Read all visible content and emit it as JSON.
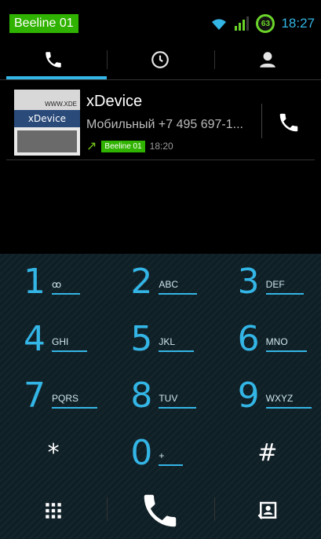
{
  "status_bar": {
    "carrier": "Beeline 01",
    "battery": "63",
    "clock": "18:27",
    "icons": [
      "wifi-icon",
      "signal-icon",
      "battery-icon"
    ]
  },
  "tabs": [
    {
      "icon": "phone-icon",
      "active": true
    },
    {
      "icon": "clock-icon",
      "active": false
    },
    {
      "icon": "contact-icon",
      "active": false
    }
  ],
  "call_log": {
    "name": "xDevice",
    "detail": "Мобильный +7 495 697-1...",
    "sim_badge": "Beeline 01",
    "time": "18:20",
    "thumb_top": "WWW.XDE",
    "thumb_brand": "xDevice",
    "direction_icon": "outgoing-arrow-icon",
    "call_button_icon": "phone-icon"
  },
  "dialpad": {
    "keys": [
      {
        "digit": "1",
        "letters": "ꝏ"
      },
      {
        "digit": "2",
        "letters": "ABC"
      },
      {
        "digit": "3",
        "letters": "DEF"
      },
      {
        "digit": "4",
        "letters": "GHI"
      },
      {
        "digit": "5",
        "letters": "JKL"
      },
      {
        "digit": "6",
        "letters": "MNO"
      },
      {
        "digit": "7",
        "letters": "PQRS"
      },
      {
        "digit": "8",
        "letters": "TUV"
      },
      {
        "digit": "9",
        "letters": "WXYZ"
      },
      {
        "digit": "*",
        "letters": ""
      },
      {
        "digit": "0",
        "letters": "+"
      },
      {
        "digit": "#",
        "letters": ""
      }
    ],
    "bottom_bar": [
      "dialpad-grid-icon",
      "call-icon",
      "add-contact-icon"
    ]
  },
  "colors": {
    "accent": "#33b5e5",
    "carrier_green": "#30b300",
    "dialpad_bg": "#0f1f26"
  }
}
